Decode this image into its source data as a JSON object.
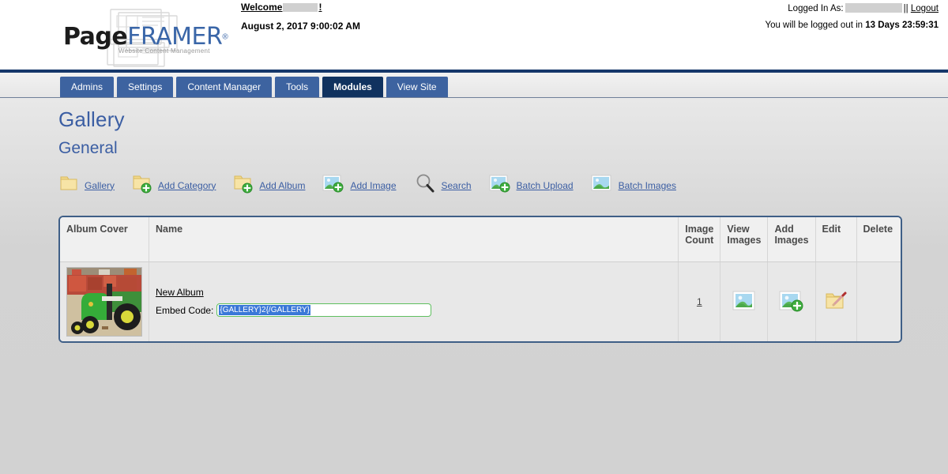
{
  "header": {
    "logo": {
      "part1": "Page",
      "part2": "FRAMER",
      "registered": "®",
      "tagline": "Website Content Management"
    },
    "welcome": {
      "label": "Welcome",
      "suffix": "!",
      "datetime": "August 2, 2017 9:00:02 AM"
    },
    "session": {
      "logged_in_as_label": "Logged In As:",
      "separator": "||",
      "logout_label": "Logout",
      "logout_notice_prefix": "You will be logged out in",
      "logout_countdown": "13 Days 23:59:31"
    }
  },
  "nav": {
    "tabs": [
      {
        "label": "Admins",
        "active": false
      },
      {
        "label": "Settings",
        "active": false
      },
      {
        "label": "Content Manager",
        "active": false
      },
      {
        "label": "Tools",
        "active": false
      },
      {
        "label": "Modules",
        "active": true
      },
      {
        "label": "View Site",
        "active": false
      }
    ]
  },
  "page": {
    "title": "Gallery",
    "subtitle": "General"
  },
  "toolbar": {
    "items": [
      {
        "label": "Gallery",
        "icon": "folder-icon"
      },
      {
        "label": "Add Category",
        "icon": "folder-add-icon"
      },
      {
        "label": "Add Album",
        "icon": "folder-add-icon"
      },
      {
        "label": "Add Image",
        "icon": "image-add-icon"
      },
      {
        "label": "Search",
        "icon": "magnifier-icon"
      },
      {
        "label": "Batch Upload",
        "icon": "image-add-icon"
      },
      {
        "label": "Batch Images",
        "icon": "image-icon"
      }
    ]
  },
  "table": {
    "columns": [
      "Album Cover",
      "Name",
      "Image Count",
      "View Images",
      "Add Images",
      "Edit",
      "Delete"
    ],
    "rows": [
      {
        "cover_alt": "green-tractor-photo",
        "name": "New Album",
        "embed_label": "Embed Code:",
        "embed_value": "{GALLERY}2{/GALLERY}",
        "image_count": "1",
        "view_images_icon": "image-icon",
        "add_images_icon": "image-add-icon",
        "edit_icon": "folder-pencil-icon",
        "delete_icon": ""
      }
    ]
  },
  "colors": {
    "accent_blue": "#3b5ea3",
    "tab_blue": "#3d63a0",
    "tab_active_blue": "#10325f",
    "header_rule": "#16386b",
    "table_border": "#3f5f87",
    "input_border_green": "#5fbf5f",
    "selection_blue": "#3a78d8"
  }
}
